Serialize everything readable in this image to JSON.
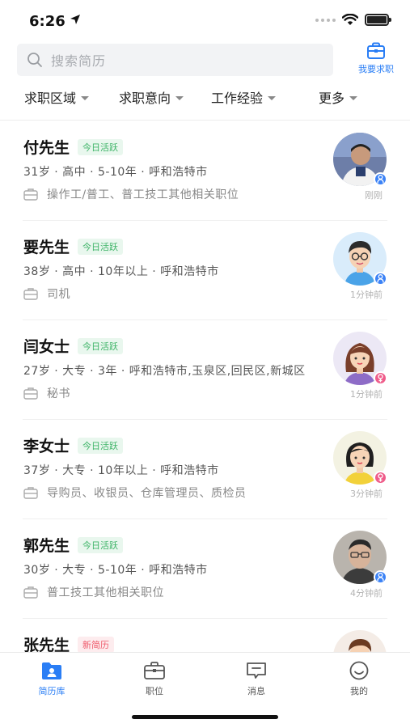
{
  "status": {
    "time": "6:26"
  },
  "search": {
    "placeholder": "搜索简历"
  },
  "job_button": {
    "label": "我要求职"
  },
  "filters": [
    {
      "label": "求职区域"
    },
    {
      "label": "求职意向"
    },
    {
      "label": "工作经验"
    },
    {
      "label": "更多"
    }
  ],
  "badges": {
    "active": "今日活跃",
    "new": "新简历"
  },
  "resumes": [
    {
      "name": "付先生",
      "badge": "今日活跃",
      "info": "31岁 · 高中 · 5-10年 · 呼和浩特市",
      "positions": "操作工/普工、普工技工其他相关职位",
      "time": "刚刚",
      "gender": "male"
    },
    {
      "name": "要先生",
      "badge": "今日活跃",
      "info": "38岁 · 高中 · 10年以上 · 呼和浩特市",
      "positions": "司机",
      "time": "1分钟前",
      "gender": "male"
    },
    {
      "name": "闫女士",
      "badge": "今日活跃",
      "info": "27岁 · 大专 · 3年 · 呼和浩特市,玉泉区,回民区,新城区",
      "positions": "秘书",
      "time": "1分钟前",
      "gender": "female"
    },
    {
      "name": "李女士",
      "badge": "今日活跃",
      "info": "37岁 · 大专 · 10年以上 · 呼和浩特市",
      "positions": "导购员、收银员、仓库管理员、质检员",
      "time": "3分钟前",
      "gender": "female"
    },
    {
      "name": "郭先生",
      "badge": "今日活跃",
      "info": "30岁 · 大专 · 5-10年 · 呼和浩特市",
      "positions": "普工技工其他相关职位",
      "time": "4分钟前",
      "gender": "male"
    },
    {
      "name": "张先生",
      "badge": "新简历",
      "info": "",
      "positions": "",
      "time": "",
      "gender": "male"
    }
  ],
  "tabs": [
    {
      "label": "简历库",
      "icon": "resume-library-icon",
      "active": true
    },
    {
      "label": "职位",
      "icon": "briefcase-icon",
      "active": false
    },
    {
      "label": "消息",
      "icon": "message-icon",
      "active": false
    },
    {
      "label": "我的",
      "icon": "smile-icon",
      "active": false
    }
  ],
  "colors": {
    "accent": "#2a7ef5",
    "active_badge": "#3fb468",
    "new_badge": "#ef5b6c",
    "male": "#3b82f6",
    "female": "#ef5c8a"
  }
}
